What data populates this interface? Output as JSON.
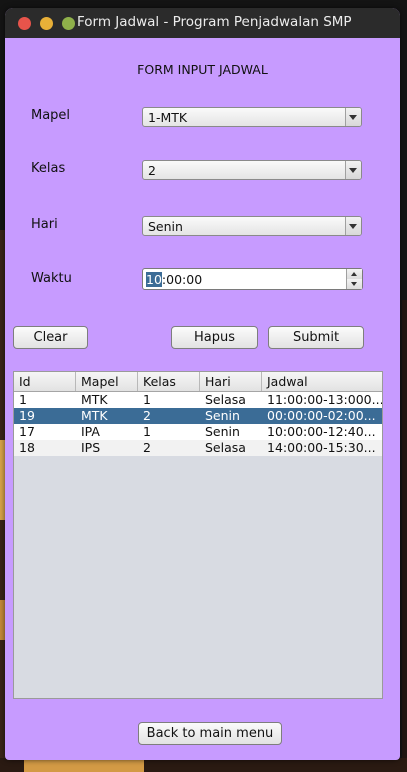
{
  "window": {
    "title": "Form Jadwal - Program Penjadwalan SMP"
  },
  "form": {
    "heading": "FORM INPUT JADWAL",
    "mapel": {
      "label": "Mapel",
      "value": "1-MTK"
    },
    "kelas": {
      "label": "Kelas",
      "value": "2"
    },
    "hari": {
      "label": "Hari",
      "value": "Senin"
    },
    "waktu": {
      "label": "Waktu",
      "value_selected": "10",
      "value_rest": ":00:00"
    }
  },
  "buttons": {
    "clear": "Clear",
    "hapus": "Hapus",
    "submit": "Submit",
    "back": "Back to main menu"
  },
  "table": {
    "columns": [
      "Id",
      "Mapel",
      "Kelas",
      "Hari",
      "Jadwal"
    ],
    "rows": [
      [
        "1",
        "MTK",
        "1",
        "Selasa",
        "11:00:00-13:000..."
      ],
      [
        "19",
        "MTK",
        "2",
        "Senin",
        "00:00:00-02:00..."
      ],
      [
        "17",
        "IPA",
        "1",
        "Senin",
        "10:00:00-12:40..."
      ],
      [
        "18",
        "IPS",
        "2",
        "Selasa",
        "14:00:00-15:30..."
      ]
    ],
    "selected_row_index": 1
  },
  "colors": {
    "window_bg": "#c79bff",
    "selection": "#3b6c96",
    "titlebar": "#2b2b2b"
  }
}
